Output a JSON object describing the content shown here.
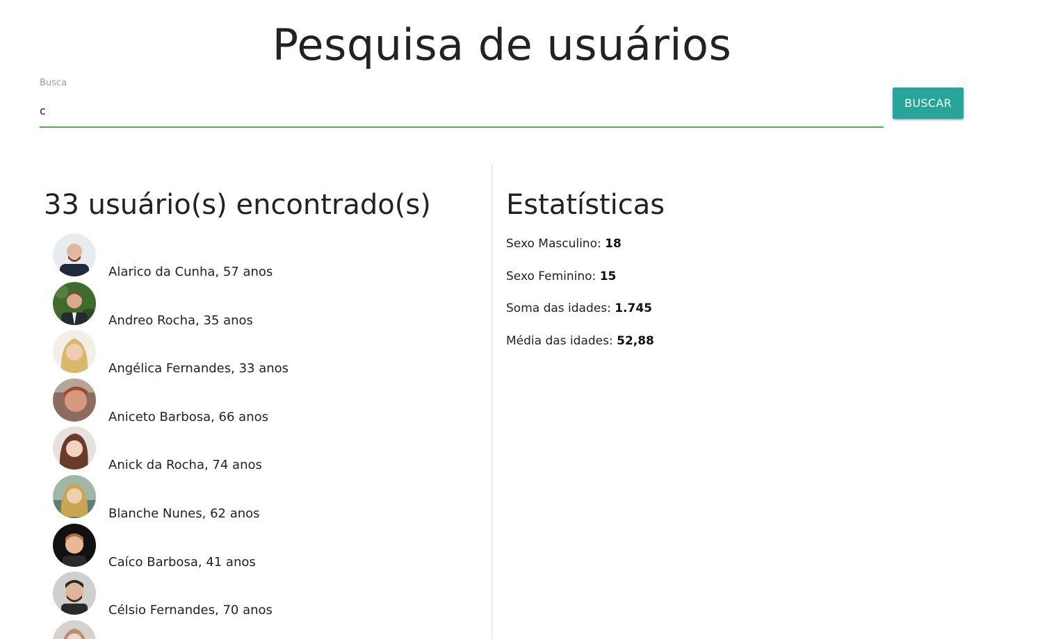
{
  "header": {
    "title": "Pesquisa de usuários"
  },
  "search": {
    "label": "Busca",
    "value": "c",
    "button_label": "BUSCAR"
  },
  "results": {
    "title": "33 usuário(s) encontrado(s)",
    "users": [
      {
        "label": "Alarico da Cunha, 57 anos",
        "avatar": "avatar-photo"
      },
      {
        "label": "Andreo Rocha, 35 anos",
        "avatar": "avatar-photo"
      },
      {
        "label": "Angélica Fernandes, 33 anos",
        "avatar": "avatar-photo"
      },
      {
        "label": "Aniceto Barbosa, 66 anos",
        "avatar": "avatar-photo"
      },
      {
        "label": "Anick da Rocha, 74 anos",
        "avatar": "avatar-photo"
      },
      {
        "label": "Blanche Nunes, 62 anos",
        "avatar": "avatar-photo"
      },
      {
        "label": "Caíco Barbosa, 41 anos",
        "avatar": "avatar-photo"
      },
      {
        "label": "Célsio Fernandes, 70 anos",
        "avatar": "avatar-photo"
      },
      {
        "label": "",
        "avatar": "avatar-photo"
      }
    ]
  },
  "stats": {
    "title": "Estatísticas",
    "items": [
      {
        "label": "Sexo Masculino: ",
        "value": "18"
      },
      {
        "label": "Sexo Feminino: ",
        "value": "15"
      },
      {
        "label": "Soma das idades: ",
        "value": "1.745"
      },
      {
        "label": "Média das idades: ",
        "value": "52,88"
      }
    ]
  },
  "colors": {
    "accent": "#26a69a",
    "input_underline": "#4caf50"
  }
}
